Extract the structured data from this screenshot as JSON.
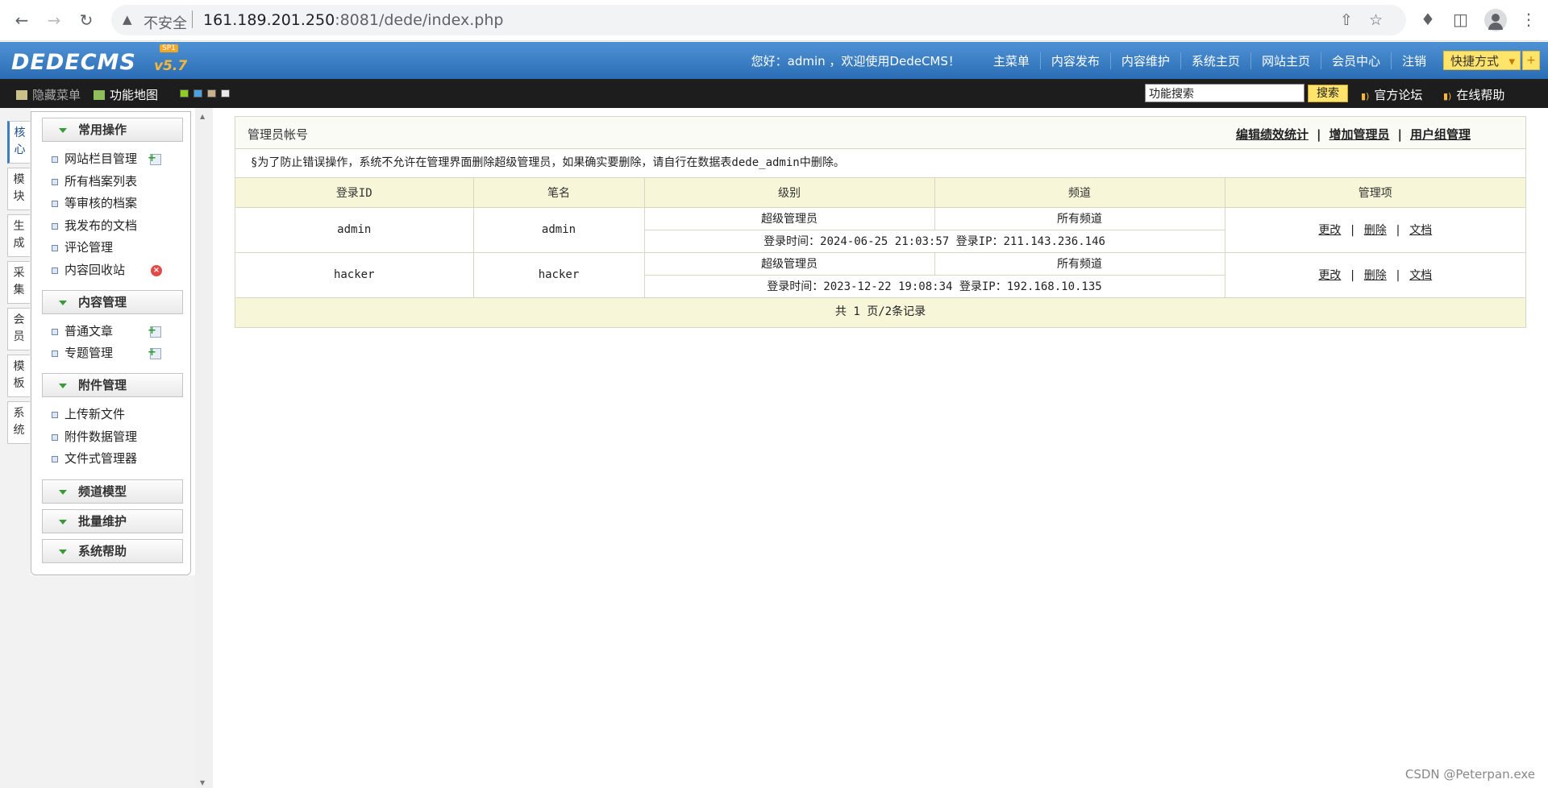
{
  "browser": {
    "insecure_label": "不安全",
    "url_host": "161.189.201.250",
    "url_port": ":8081",
    "url_path": "/dede/index.php"
  },
  "header": {
    "logo": "DEDECMS",
    "version": "v5.7",
    "edition_badge": "SP1",
    "welcome": "您好：admin ，欢迎使用DedeCMS！",
    "nav": [
      "主菜单",
      "内容发布",
      "内容维护",
      "系统主页",
      "网站主页",
      "会员中心",
      "注销"
    ],
    "quick_label": "快捷方式"
  },
  "toolbar": {
    "hide_menu": "隐藏菜单",
    "feature_map": "功能地图",
    "search_value": "功能搜索",
    "search_button": "搜索",
    "forum": "官方论坛",
    "help": "在线帮助",
    "swatch_colors": [
      "#8fce1e",
      "#4aa3df",
      "#c8b08a",
      "#e8e8e8"
    ]
  },
  "side_tabs": [
    "核心",
    "模块",
    "生成",
    "采集",
    "会员",
    "模板",
    "系统"
  ],
  "menu": {
    "groups": [
      {
        "title": "常用操作",
        "items": [
          "网站栏目管理",
          "所有档案列表",
          "等审核的档案",
          "我发布的文档",
          "评论管理",
          "内容回收站"
        ]
      },
      {
        "title": "内容管理",
        "items": [
          "普通文章",
          "专题管理"
        ]
      },
      {
        "title": "附件管理",
        "items": [
          "上传新文件",
          "附件数据管理",
          "文件式管理器"
        ]
      },
      {
        "title": "频道模型",
        "items": []
      },
      {
        "title": "批量维护",
        "items": []
      },
      {
        "title": "系统帮助",
        "items": []
      }
    ]
  },
  "content": {
    "title": "管理员帐号",
    "links": [
      "编辑绩效统计",
      "增加管理员",
      "用户组管理"
    ],
    "notice": "§为了防止错误操作，系统不允许在管理界面删除超级管理员，如果确实要删除，请自行在数据表dede_admin中删除。",
    "columns": [
      "登录ID",
      "笔名",
      "级别",
      "频道",
      "管理项"
    ],
    "rows": [
      {
        "id": "admin",
        "pen_name": "admin",
        "level": "超级管理员",
        "channel": "所有频道",
        "login_info": "登录时间：2024-06-25 21:03:57  登录IP：211.143.236.146",
        "actions": [
          "更改",
          "删除",
          "文档"
        ]
      },
      {
        "id": "hacker",
        "pen_name": "hacker",
        "level": "超级管理员",
        "channel": "所有频道",
        "login_info": "登录时间：2023-12-22 19:08:34  登录IP：192.168.10.135",
        "actions": [
          "更改",
          "删除",
          "文档"
        ]
      }
    ],
    "pager": "共 1 页/2条记录"
  },
  "watermark": "CSDN @Peterpan.exe"
}
